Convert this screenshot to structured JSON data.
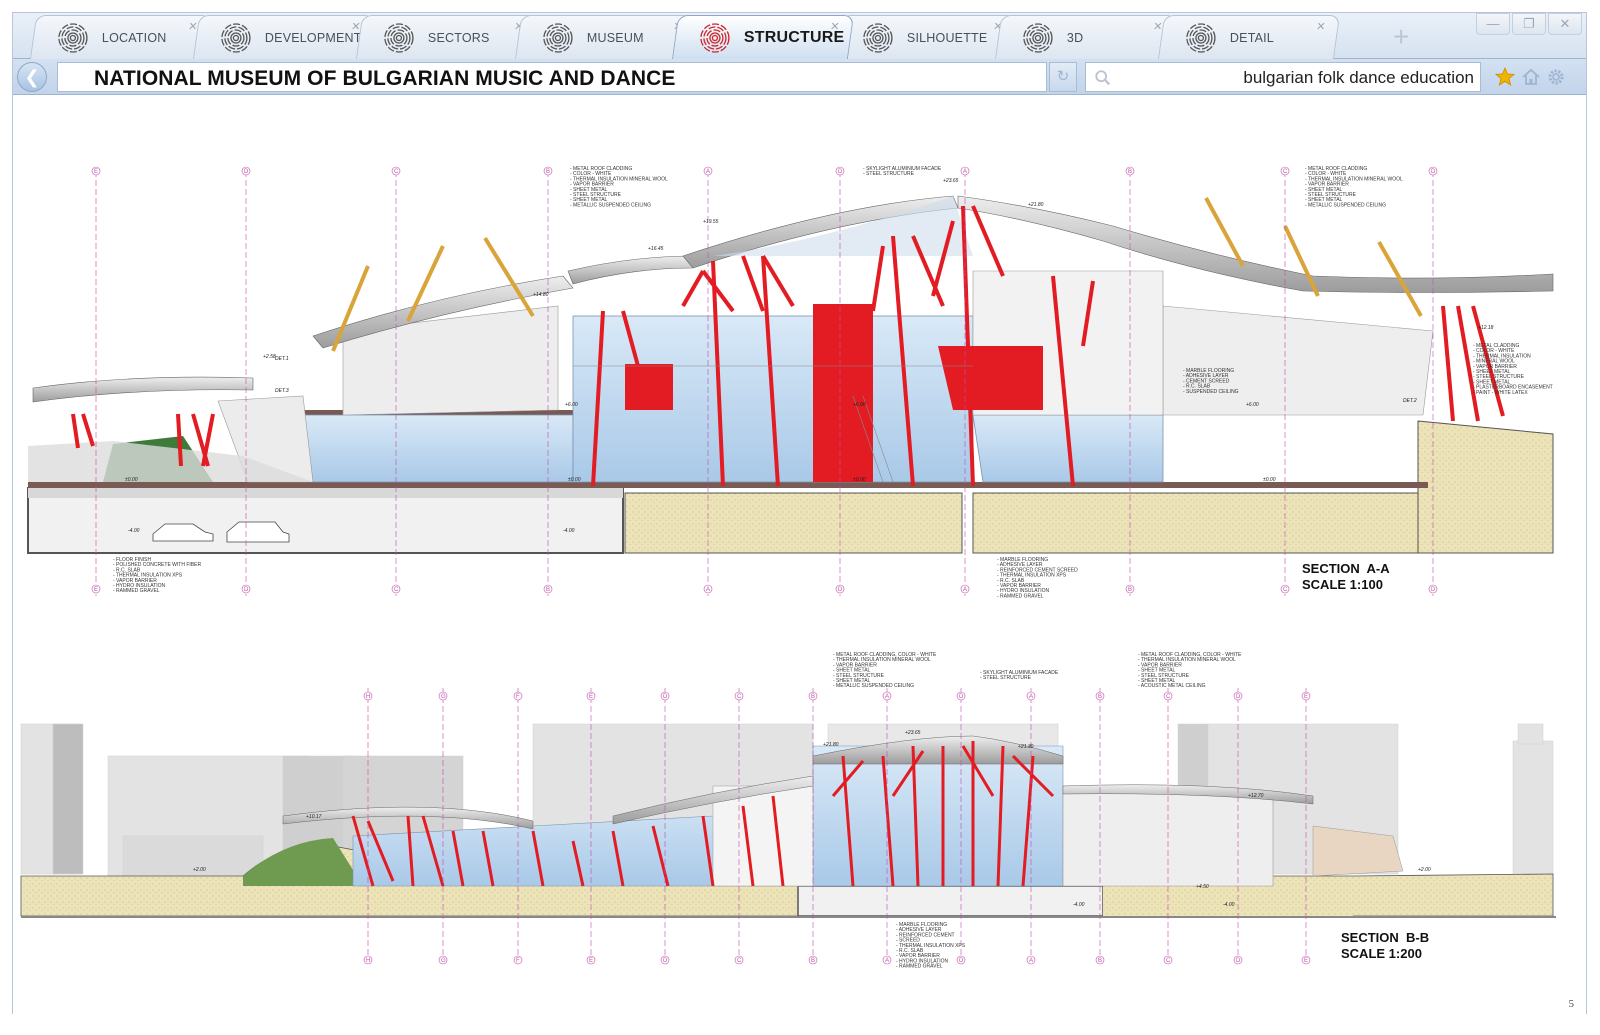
{
  "tabs": [
    {
      "label": "LOCATION",
      "icon": "fingerprint-icon",
      "active": false
    },
    {
      "label": "DEVELOPMENT",
      "icon": "fingerprint-icon",
      "active": false
    },
    {
      "label": "SECTORS",
      "icon": "fingerprint-icon",
      "active": false
    },
    {
      "label": "MUSEUM",
      "icon": "fingerprint-icon",
      "active": false
    },
    {
      "label": "STRUCTURE",
      "icon": "fingerprint-icon",
      "active": true
    },
    {
      "label": "SILHOUETTE",
      "icon": "fingerprint-icon",
      "active": false
    },
    {
      "label": "3D",
      "icon": "fingerprint-icon",
      "active": false
    },
    {
      "label": "DETAIL",
      "icon": "fingerprint-icon",
      "active": false
    }
  ],
  "new_tab": "+",
  "window_controls": {
    "minimize": "—",
    "maximize": "❐",
    "close": "✕"
  },
  "address": {
    "title": "NATIONAL MUSEUM OF BULGARIAN MUSIC AND DANCE",
    "search_query": "bulgarian folk dance education"
  },
  "sections": {
    "a": {
      "name": "SECTION  A-A",
      "scale": "SCALE 1:100"
    },
    "b": {
      "name": "SECTION  B-B",
      "scale": "SCALE 1:200"
    }
  },
  "grid_axes_a": [
    "E",
    "D",
    "C",
    "B",
    "A",
    "D",
    "A",
    "B",
    "C",
    "D"
  ],
  "grid_axes_b": [
    "H",
    "G",
    "F",
    "E",
    "D",
    "C",
    "B",
    "A",
    "D",
    "A",
    "B",
    "C",
    "D",
    "E"
  ],
  "notes_a": {
    "roof_left": [
      "METAL ROOF CLADDING",
      "COLOR - WHITE",
      "THERMAL INSULATION MINERAL WOOL",
      "VAPOR BARRIER",
      "SHEET METAL",
      "STEEL STRUCTURE",
      "SHEET METAL",
      "METALLIC SUSPENDED CEILING"
    ],
    "skylight": [
      "SKYLIGHT ALUMINIUM FACADE",
      "STEEL STRUCTURE"
    ],
    "roof_right": [
      "METAL ROOF CLADDING",
      "COLOR - WHITE",
      "THERMAL INSULATION MINERAL WOOL",
      "VAPOR BARRIER",
      "SHEET METAL",
      "STEEL STRUCTURE",
      "SHEET METAL",
      "METALLIC SUSPENDED CEILING"
    ],
    "wall": [
      "METAL CLADDING",
      "COLOR - WHITE",
      "THERMAL INSULATION",
      "MINERAL WOOL",
      "VAPOR BARRIER",
      "SHEET METAL",
      "STEEL STRUCTURE",
      "SHEET METAL",
      "PLASTERBOARD ENCASEMENT",
      "PAINT - WHITE LATEX"
    ],
    "floor_mid": [
      "MARBLE FLOORING",
      "ADHESIVE LAYER",
      "CEMENT SCREED",
      "R.C. SLAB",
      "SUSPENDED CEILING"
    ],
    "floor_left": [
      "FLOOR FINISH",
      "POLISHED CONCRETE WITH FIBER",
      "R.C. SLAB",
      "THERMAL INSULATION XPS",
      "VAPOR BARRIER",
      "HYDRO INSULATION",
      "RAMMED GRAVEL"
    ],
    "floor_right": [
      "MARBLE FLOORING",
      "ADHESIVE LAYER",
      "REINFORCED CEMENT SCREED",
      "THERMAL INSULATION XPS",
      "R.C. SLAB",
      "VAPOR BARRIER",
      "HYDRO INSULATION",
      "RAMMED GRAVEL"
    ]
  },
  "notes_b": {
    "roof_left": [
      "METAL ROOF CLADDING, COLOR - WHITE",
      "THERMAL INSULATION MINERAL WOOL",
      "VAPOR BARRIER",
      "SHEET METAL",
      "STEEL STRUCTURE",
      "SHEET METAL",
      "METALLIC SUSPENDED CEILING"
    ],
    "skylight": [
      "SKYLIGHT ALUMINIUM FACADE",
      "STEEL STRUCTURE"
    ],
    "roof_right": [
      "METAL ROOF CLADDING, COLOR - WHITE",
      "THERMAL INSULATION MINERAL WOOL",
      "VAPOR BARRIER",
      "SHEET METAL",
      "STEEL STRUCTURE",
      "SHEET METAL",
      "ACOUSTIC METAL CEILING"
    ],
    "floor": [
      "MARBLE FLOORING",
      "ADHESIVE LAYER",
      "REINFORCED CEMENT",
      "SCREED",
      "THERMAL INSULATION XPS",
      "R.C. SLAB",
      "VAPOR BARRIER",
      "HYDRO INSULATION",
      "RAMMED GRAVEL"
    ]
  },
  "levels_a": [
    "+23.65",
    "+21.80",
    "+19.55",
    "+16.45",
    "+14.80",
    "+2.58",
    "+6.00",
    "+6.00",
    "+6.00",
    "±0.00",
    "±0.00",
    "±0.00",
    "±0.00",
    "-4.00",
    "-4.00",
    "+12.18"
  ],
  "det_labels": [
    "DET.1",
    "DET.2",
    "DET.3"
  ],
  "levels_b": [
    "+23.65",
    "+21.80",
    "+21.30",
    "+12.70",
    "+10.17",
    "+2.00",
    "+2.00",
    "-4.00",
    "-4.00",
    "+4.50"
  ],
  "page_number": "5",
  "colors": {
    "accent_red": "#e21c22",
    "tab_bg": "#d6e2f0",
    "grid_magenta": "#c04ca8",
    "soil": "#ece3b8",
    "glass": "#bcd7ef"
  }
}
